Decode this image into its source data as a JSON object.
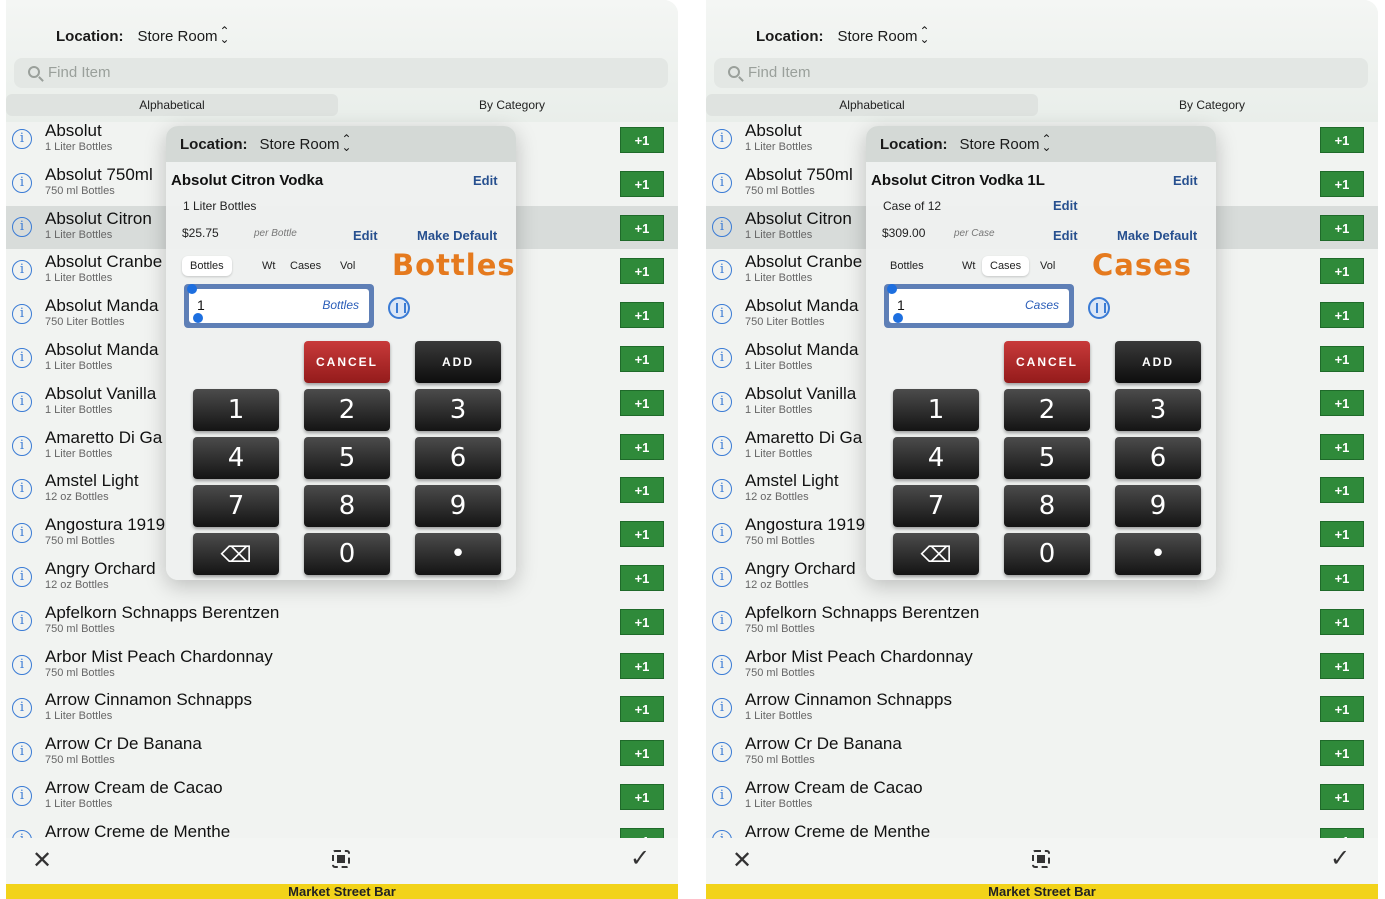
{
  "colors": {
    "accent_green": "#2f8a3a",
    "link_blue": "#27508f",
    "unit_orange": "#e57a1e",
    "cancel_red": "#b02a2a",
    "footer_yellow": "#f2d31a"
  },
  "icons": [
    "info-icon",
    "search-icon",
    "chevron-updown-icon",
    "close-icon",
    "scan-icon",
    "checkmark-icon",
    "backspace-icon",
    "voice-icon"
  ],
  "panels": [
    {
      "location_label": "Location:",
      "location_value": "Store Room",
      "search_placeholder": "Find Item",
      "tabs": [
        "Alphabetical",
        "By Category"
      ],
      "items": [
        {
          "name": "Absolut",
          "sub": "1 Liter Bottles",
          "add": "+1"
        },
        {
          "name": "Absolut 750ml",
          "sub": "750 ml Bottles",
          "add": "+1"
        },
        {
          "name": "Absolut Citron",
          "sub": "1 Liter Bottles",
          "add": "+1"
        },
        {
          "name": "Absolut Cranbe",
          "sub": "1 Liter Bottles",
          "add": "+1"
        },
        {
          "name": "Absolut Manda",
          "sub": "750 Liter Bottles",
          "add": "+1"
        },
        {
          "name": "Absolut Manda",
          "sub": "1 Liter Bottles",
          "add": "+1"
        },
        {
          "name": "Absolut Vanilla",
          "sub": "1 Liter Bottles",
          "add": "+1"
        },
        {
          "name": "Amaretto Di Ga",
          "sub": "1 Liter Bottles",
          "add": "+1"
        },
        {
          "name": "Amstel Light",
          "sub": "12 oz Bottles",
          "add": "+1"
        },
        {
          "name": "Angostura 1919",
          "sub": "750 ml Bottles",
          "add": "+1"
        },
        {
          "name": "Angry Orchard",
          "sub": "12 oz Bottles",
          "add": "+1"
        },
        {
          "name": "Apfelkorn Schnapps Berentzen",
          "sub": "750 ml Bottles",
          "add": "+1"
        },
        {
          "name": "Arbor Mist Peach Chardonnay",
          "sub": "750 ml Bottles",
          "add": "+1"
        },
        {
          "name": "Arrow Cinnamon Schnapps",
          "sub": "1 Liter Bottles",
          "add": "+1"
        },
        {
          "name": "Arrow Cr De Banana",
          "sub": "750 ml Bottles",
          "add": "+1"
        },
        {
          "name": "Arrow Cream de Cacao",
          "sub": "1 Liter Bottles",
          "add": "+1"
        },
        {
          "name": "Arrow Creme de Menthe",
          "sub": "",
          "add": "+1"
        }
      ],
      "modal": {
        "location_label": "Location:",
        "location_value": "Store Room",
        "item_name": "Absolut Citron Vodka",
        "edit": "Edit",
        "case_text": "1 Liter Bottles",
        "case_edit": "",
        "price": "$25.75",
        "per": "per Bottle",
        "make_default": "Make Default",
        "units": [
          "Bottles",
          "Wt",
          "Cases",
          "Vol"
        ],
        "selected_unit": "Bottles",
        "big_unit": "Bottles",
        "input_value": "1",
        "input_unit": "Bottles",
        "cancel": "CANCEL",
        "add": "ADD",
        "keys": [
          "1",
          "2",
          "3",
          "4",
          "5",
          "6",
          "7",
          "8",
          "9",
          "",
          "0",
          "•"
        ]
      },
      "footer": "Market Street Bar"
    },
    {
      "location_label": "Location:",
      "location_value": "Store Room",
      "search_placeholder": "Find Item",
      "tabs": [
        "Alphabetical",
        "By Category"
      ],
      "items": [
        {
          "name": "Absolut",
          "sub": "1 Liter Bottles",
          "add": "+1"
        },
        {
          "name": "Absolut 750ml",
          "sub": "750 ml Bottles",
          "add": "+1"
        },
        {
          "name": "Absolut Citron",
          "sub": "1 Liter Bottles",
          "add": "+1"
        },
        {
          "name": "Absolut Cranbe",
          "sub": "1 Liter Bottles",
          "add": "+1"
        },
        {
          "name": "Absolut Manda",
          "sub": "750 Liter Bottles",
          "add": "+1"
        },
        {
          "name": "Absolut Manda",
          "sub": "1 Liter Bottles",
          "add": "+1"
        },
        {
          "name": "Absolut Vanilla",
          "sub": "1 Liter Bottles",
          "add": "+1"
        },
        {
          "name": "Amaretto Di Ga",
          "sub": "1 Liter Bottles",
          "add": "+1"
        },
        {
          "name": "Amstel Light",
          "sub": "12 oz Bottles",
          "add": "+1"
        },
        {
          "name": "Angostura 1919",
          "sub": "750 ml Bottles",
          "add": "+1"
        },
        {
          "name": "Angry Orchard",
          "sub": "12 oz Bottles",
          "add": "+1"
        },
        {
          "name": "Apfelkorn Schnapps Berentzen",
          "sub": "750 ml Bottles",
          "add": "+1"
        },
        {
          "name": "Arbor Mist Peach Chardonnay",
          "sub": "750 ml Bottles",
          "add": "+1"
        },
        {
          "name": "Arrow Cinnamon Schnapps",
          "sub": "1 Liter Bottles",
          "add": "+1"
        },
        {
          "name": "Arrow Cr De Banana",
          "sub": "750 ml Bottles",
          "add": "+1"
        },
        {
          "name": "Arrow Cream de Cacao",
          "sub": "1 Liter Bottles",
          "add": "+1"
        },
        {
          "name": "Arrow Creme de Menthe",
          "sub": "",
          "add": "+1"
        }
      ],
      "modal": {
        "location_label": "Location:",
        "location_value": "Store Room",
        "item_name": "Absolut Citron Vodka 1L",
        "edit": "Edit",
        "case_text": "Case of 12",
        "case_edit": "Edit",
        "price": "$309.00",
        "per": "per Case",
        "make_default": "Make Default",
        "units": [
          "Bottles",
          "Wt",
          "Cases",
          "Vol"
        ],
        "selected_unit": "Cases",
        "big_unit": "Cases",
        "input_value": "1",
        "input_unit": "Cases",
        "cancel": "CANCEL",
        "add": "ADD",
        "keys": [
          "1",
          "2",
          "3",
          "4",
          "5",
          "6",
          "7",
          "8",
          "9",
          "",
          "0",
          "•"
        ]
      },
      "footer": "Market Street Bar"
    }
  ]
}
